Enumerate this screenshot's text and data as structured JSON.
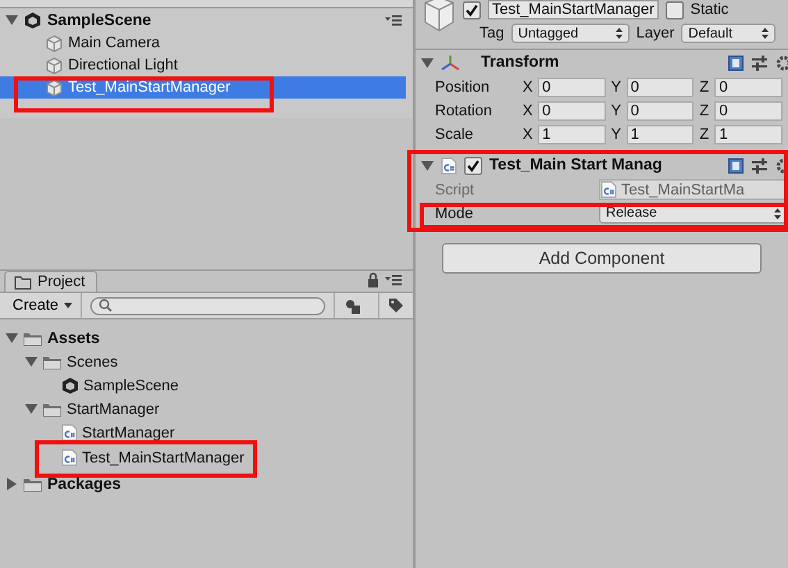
{
  "hierarchy": {
    "scene": "SampleScene",
    "expanded": true,
    "items": [
      {
        "label": "Main Camera",
        "selected": false,
        "marked": false
      },
      {
        "label": "Directional Light",
        "selected": false,
        "marked": false
      },
      {
        "label": "Test_MainStartManager",
        "selected": true,
        "marked": true
      }
    ]
  },
  "project": {
    "tab": "Project",
    "create": "Create",
    "tree": [
      {
        "label": "Assets",
        "kind": "folder",
        "expanded": true,
        "marked": false,
        "children": [
          {
            "label": "Scenes",
            "kind": "folder",
            "expanded": true,
            "marked": false,
            "children": [
              {
                "label": "SampleScene",
                "kind": "scene",
                "marked": false
              }
            ]
          },
          {
            "label": "StartManager",
            "kind": "folder",
            "expanded": true,
            "marked": false,
            "children": [
              {
                "label": "StartManager",
                "kind": "script",
                "marked": false
              },
              {
                "label": "Test_MainStartManager",
                "kind": "script",
                "marked": true
              }
            ]
          }
        ]
      },
      {
        "label": "Packages",
        "kind": "folder",
        "expanded": false,
        "marked": false
      }
    ]
  },
  "inspector": {
    "active": true,
    "name": "Test_MainStartManager",
    "static_label": "Static",
    "static": false,
    "tag_label": "Tag",
    "tag": "Untagged",
    "layer_label": "Layer",
    "layer": "Default",
    "components": [
      {
        "kind": "transform",
        "title": "Transform",
        "expanded": true,
        "marked": false,
        "rows": [
          {
            "label": "Position",
            "fields": [
              {
                "axis": "X",
                "value": "0"
              },
              {
                "axis": "Y",
                "value": "0"
              },
              {
                "axis": "Z",
                "value": "0"
              }
            ]
          },
          {
            "label": "Rotation",
            "fields": [
              {
                "axis": "X",
                "value": "0"
              },
              {
                "axis": "Y",
                "value": "0"
              },
              {
                "axis": "Z",
                "value": "0"
              }
            ]
          },
          {
            "label": "Scale",
            "fields": [
              {
                "axis": "X",
                "value": "1"
              },
              {
                "axis": "Y",
                "value": "1"
              },
              {
                "axis": "Z",
                "value": "1"
              }
            ]
          }
        ]
      },
      {
        "kind": "script",
        "title": "Test_Main Start Manag",
        "expanded": true,
        "enabled": true,
        "marked": true,
        "props": [
          {
            "kind": "object",
            "label": "Script",
            "value": "Test_MainStartMa",
            "disabled": true,
            "marked": false
          },
          {
            "kind": "dropdown",
            "label": "Mode",
            "value": "Release",
            "disabled": false,
            "marked": true
          }
        ]
      }
    ],
    "add_button": "Add Component"
  }
}
